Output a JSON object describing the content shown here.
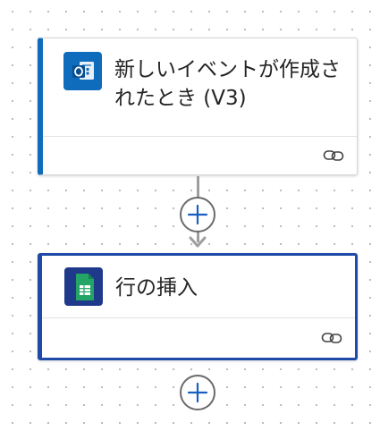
{
  "flow": {
    "steps": [
      {
        "title": "新しいイベントが作成されたとき (V3)",
        "icon": "outlook-calendar-icon",
        "accent_color": "#0f6cbd"
      },
      {
        "title": "行の挿入",
        "icon": "spreadsheet-table-icon",
        "accent_color": "#1f4aa8"
      }
    ]
  },
  "colors": {
    "canvas_dot": "#b9b9b9",
    "connector": "#9e9e9e",
    "add_button_plus": "#1a5fc0",
    "add_button_border": "#6a6a6a"
  }
}
